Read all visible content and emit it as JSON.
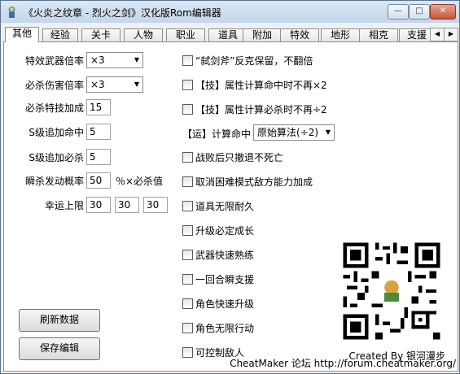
{
  "window": {
    "title": "《火炎之纹章 - 烈火之剑》汉化版Rom编辑器",
    "buttons": {
      "minimize": "—",
      "maximize": "□",
      "close": "✕"
    }
  },
  "tabs": [
    "其他",
    "经验",
    "关卡",
    "人物",
    "职业",
    "道具",
    "附加",
    "特效",
    "地形",
    "相克",
    "支援"
  ],
  "tab_scroll": {
    "left": "◀",
    "right": "▶"
  },
  "left": {
    "special_weapon_rate": {
      "label": "特效武器倍率",
      "value": "×3"
    },
    "crit_damage_rate": {
      "label": "必杀伤害倍率",
      "value": "×3"
    },
    "crit_skill_bonus": {
      "label": "必杀特技加成",
      "value": "15"
    },
    "s_rank_hit": {
      "label": "S级追加命中",
      "value": "5"
    },
    "s_rank_crit": {
      "label": "S级追加必杀",
      "value": "5"
    },
    "instant_kill": {
      "label": "瞬杀发动概率",
      "value": "50",
      "suffix": "％×必杀值"
    },
    "luck_cap": {
      "label": "幸运上限",
      "values": [
        "30",
        "30",
        "30"
      ]
    }
  },
  "checks": [
    "“弑剑斧”反克保留，不翻倍",
    "【技】属性计算命中时不再×2",
    "【技】属性计算必杀时不再÷2",
    "战败后只撤退不死亡",
    "取消困难模式敌方能力加成",
    "道具无限耐久",
    "升级必定成长",
    "武器快速熟练",
    "一回合瞬支援",
    "角色快速升级",
    "角色无限行动",
    "可控制敌人"
  ],
  "luck_calc": {
    "label": "【运】计算命中",
    "value": "原始算法(÷2)"
  },
  "buttons": {
    "refresh": "刷新数据",
    "save": "保存编辑"
  },
  "credit": "Created By 银河漫步",
  "footer": "CheatMaker 论坛 http://forum.cheatmaker.org/"
}
